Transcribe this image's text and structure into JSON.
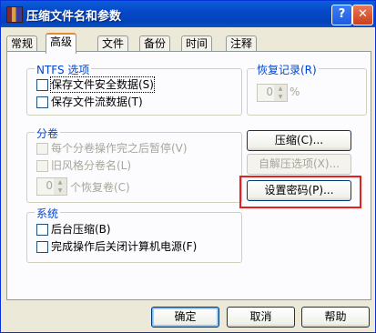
{
  "window": {
    "title": "压缩文件名和参数",
    "help_button": "?",
    "close_button": "✕"
  },
  "tabs": [
    {
      "label": "常规",
      "active": false
    },
    {
      "label": "高级",
      "active": true
    },
    {
      "label": "文件",
      "active": false
    },
    {
      "label": "备份",
      "active": false
    },
    {
      "label": "时间",
      "active": false
    },
    {
      "label": "注释",
      "active": false
    }
  ],
  "ntfs": {
    "legend": "NTFS 选项",
    "save_security": "保存文件安全数据(S)",
    "save_streams": "保存文件流数据(T)"
  },
  "recovery": {
    "legend": "恢复记录(R)",
    "value": "0",
    "unit": "%"
  },
  "volume": {
    "legend": "分卷",
    "pause_each": "每个分卷操作完之后暂停(V)",
    "old_style": "旧风格分卷名(L)",
    "recovery_value": "0",
    "recovery_label": "个恢复卷(C)"
  },
  "system": {
    "legend": "系统",
    "background": "后台压缩(B)",
    "shutdown": "完成操作后关闭计算机电源(F)"
  },
  "side_buttons": {
    "compression": "压缩(C)...",
    "sfx": "自解压选项(X)...",
    "password": "设置密码(P)..."
  },
  "footer": {
    "ok": "确定",
    "cancel": "取消",
    "help": "帮助"
  }
}
